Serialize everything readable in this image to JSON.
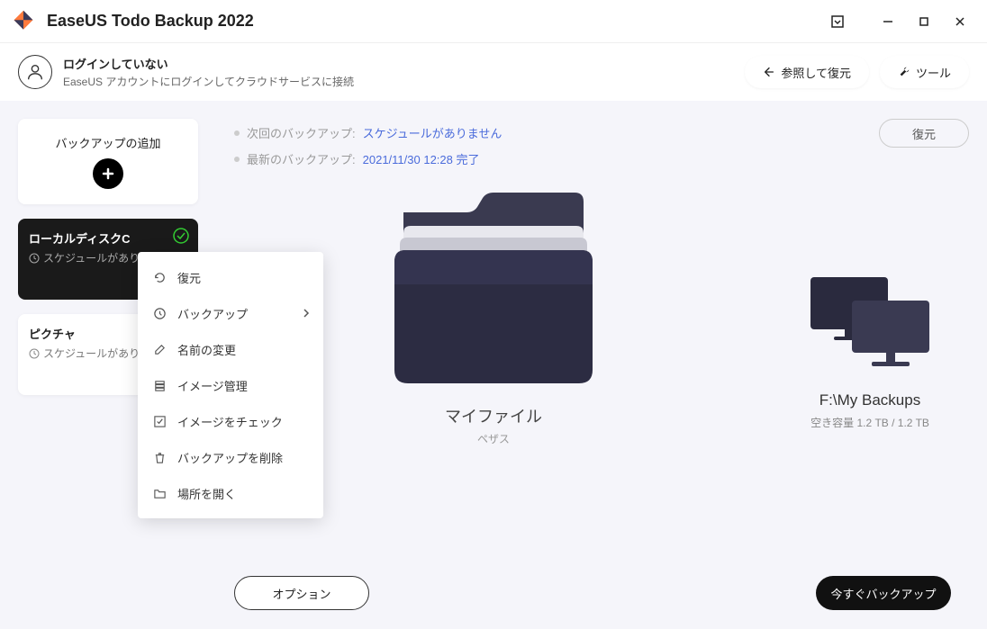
{
  "app": {
    "title": "EaseUS Todo Backup 2022"
  },
  "user": {
    "not_logged_in": "ログインしていない",
    "login_prompt": "EaseUS アカウントにログインしてクラウドサービスに接続"
  },
  "topbuttons": {
    "browse_restore": "参照して復元",
    "tools": "ツール"
  },
  "sidebar": {
    "add_backup": "バックアップの追加",
    "tasks": [
      {
        "name": "ローカルディスクC",
        "sched": "スケジュールがありません"
      },
      {
        "name": "ピクチャ",
        "sched": "スケジュールがありません"
      }
    ]
  },
  "status": {
    "next_label": "次回のバックアップ:",
    "next_value": "スケジュールがありません",
    "last_label": "最新のバックアップ:",
    "last_value": "2021/11/30 12:28 完了"
  },
  "folder": {
    "title": "マイファイル",
    "sub": "ペザス"
  },
  "restore_btn": "復元",
  "destination": {
    "path": "F:\\My Backups",
    "free_label": "空き容量",
    "free_value": "1.2 TB / 1.2 TB"
  },
  "footer": {
    "options": "オプション",
    "backup_now": "今すぐバックアップ"
  },
  "context_menu": {
    "restore": "復元",
    "backup": "バックアップ",
    "rename": "名前の変更",
    "image_manage": "イメージ管理",
    "image_check": "イメージをチェック",
    "delete": "バックアップを削除",
    "open_location": "場所を開く"
  }
}
